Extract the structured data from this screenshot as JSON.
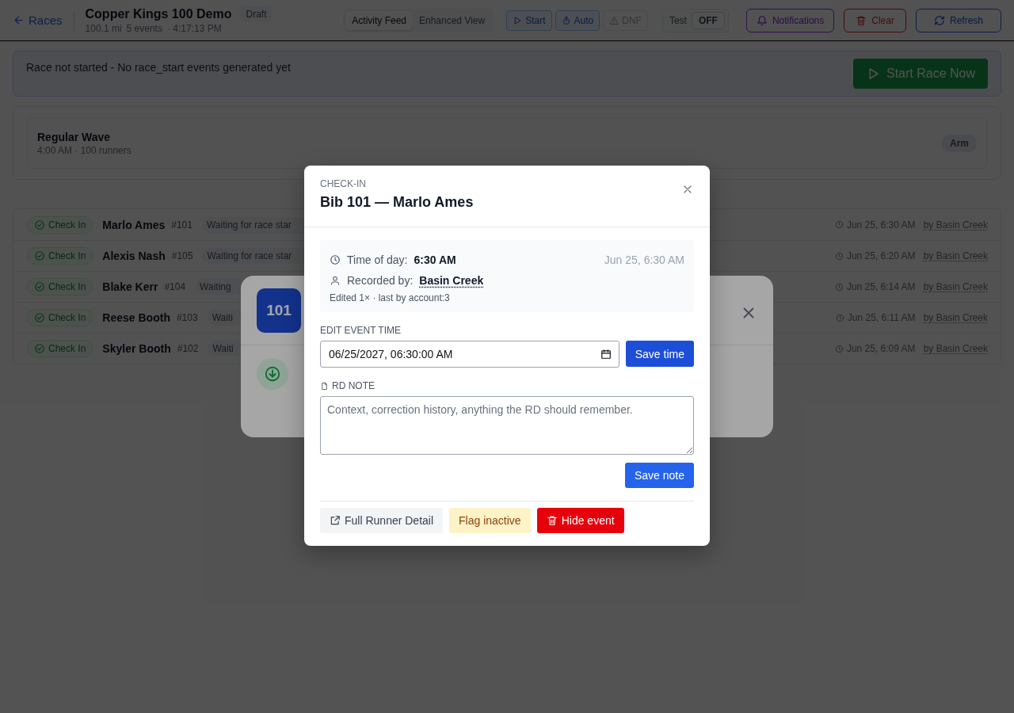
{
  "header": {
    "back_link": "Races",
    "title": "Copper Kings 100 Demo",
    "status_badge": "Draft",
    "meta": [
      "100.1 mi",
      "5 events",
      "· 4:17:13 PM"
    ],
    "view_tabs": [
      {
        "label": "Activity Feed",
        "selected": true
      },
      {
        "label": "Enhanced View",
        "selected": false
      }
    ],
    "actions": [
      {
        "label": "Start",
        "kind": "start",
        "disabled": false
      },
      {
        "label": "Auto",
        "kind": "auto",
        "disabled": false
      },
      {
        "label": "DNF",
        "kind": "dnf",
        "disabled": true
      }
    ],
    "test_toggle": {
      "label": "Test",
      "value": "OFF",
      "on": false
    },
    "tools": [
      {
        "label": "Notifications",
        "kind": "notifications"
      },
      {
        "label": "Clear",
        "kind": "clear"
      },
      {
        "label": "Refresh",
        "kind": "refresh"
      }
    ]
  },
  "banner": {
    "message": "Race not started - No race_start events generated yet",
    "button": "Start Race Now"
  },
  "waves": [
    {
      "name": "Regular Wave",
      "detail": "4:00 AM · 100 runners",
      "action": "Arm"
    }
  ],
  "events": [
    {
      "type": "Check In",
      "runner": "Marlo Ames",
      "bib": "#101",
      "status": "Waiting for race star",
      "time": "Jun 25, 6:30 AM",
      "recorded_by": "by Basin Creek"
    },
    {
      "type": "Check In",
      "runner": "Alexis Nash",
      "bib": "#105",
      "status": "Waiting for race star",
      "time": "Jun 25, 6:20 AM",
      "recorded_by": "by Basin Creek"
    },
    {
      "type": "Check In",
      "runner": "Blake Kerr",
      "bib": "#104",
      "status": "Waiting",
      "time": "Jun 25, 6:14 AM",
      "recorded_by": "by Basin Creek"
    },
    {
      "type": "Check In",
      "runner": "Reese Booth",
      "bib": "#103",
      "status": "Waiti",
      "time": "Jun 25, 6:11 AM",
      "recorded_by": "by Basin Creek"
    },
    {
      "type": "Check In",
      "runner": "Skyler Booth",
      "bib": "#102",
      "status": "Waiti",
      "time": "Jun 25, 6:09 AM",
      "recorded_by": "by Basin Creek"
    }
  ],
  "runner_panel": {
    "bib": "101"
  },
  "event_dialog": {
    "eyebrow": "CHECK-IN",
    "title": "Bib 101 — Marlo Ames",
    "time_label": "Time of day:",
    "time_value": "6:30 AM",
    "timestamp": "Jun 25, 6:30 AM",
    "recorded_label": "Recorded by:",
    "recorded_value": "Basin Creek",
    "edit_note": "Edited 1× · last by account:3",
    "edit_time_label": "EDIT EVENT TIME",
    "time_input": "06/25/2027, 06:30:00 AM",
    "save_time": "Save time",
    "note_label": "RD NOTE",
    "note_placeholder": "Context, correction history, anything the RD should remember.",
    "save_note": "Save note",
    "footer_buttons": [
      {
        "label": "Full Runner Detail",
        "kind": "detail"
      },
      {
        "label": "Flag inactive",
        "kind": "flag"
      },
      {
        "label": "Hide event",
        "kind": "hide"
      }
    ]
  }
}
